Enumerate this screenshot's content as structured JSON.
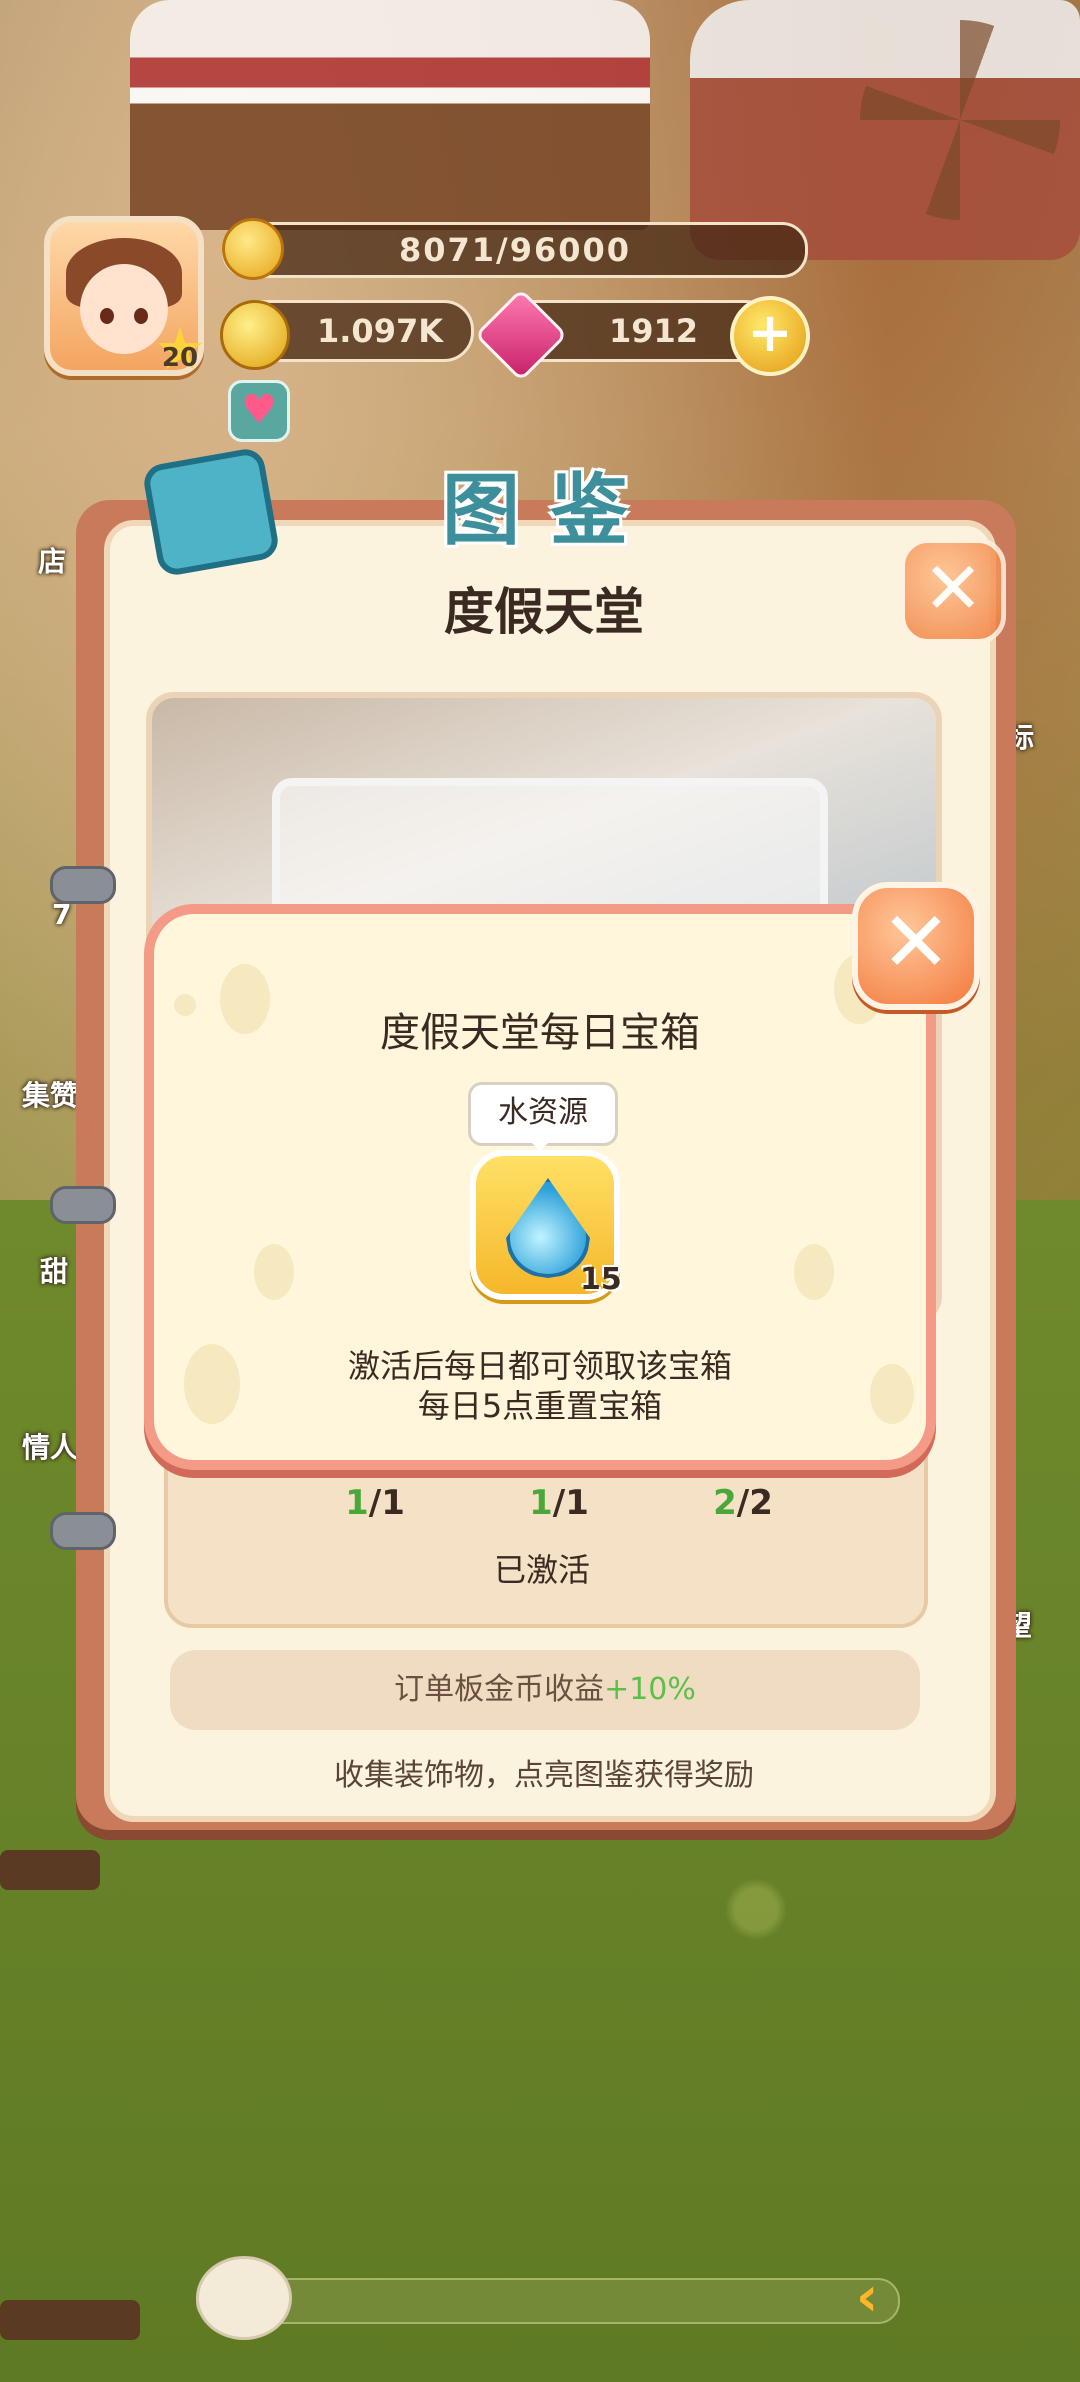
{
  "hud": {
    "level": "20",
    "xp": "8071/96000",
    "coins": "1.097K",
    "gems": "1912",
    "plus_symbol": "+",
    "heart_symbol": "♥"
  },
  "side_labels": {
    "shop": "店",
    "tag": "标",
    "seven": "7",
    "collect": "集赞",
    "sweet": "甜",
    "lover": "情人",
    "wish": "望"
  },
  "album": {
    "banner_title": "图鉴",
    "heading": "度假天堂",
    "close_symbol": "✕",
    "counts": [
      {
        "done": "1",
        "total": "/1"
      },
      {
        "done": "1",
        "total": "/1"
      },
      {
        "done": "2",
        "total": "/2"
      }
    ],
    "status": "已激活",
    "bonus_label": "订单板金币收益",
    "bonus_value": "+10%",
    "footer_hint": "收集装饰物，点亮图鉴获得奖励"
  },
  "popup": {
    "title": "度假天堂每日宝箱",
    "close_symbol": "✕",
    "reward": {
      "name": "水资源",
      "quantity": "15"
    },
    "description_line1": "激活后每日都可领取该宝箱",
    "description_line2": "每日5点重置宝箱"
  },
  "chat": {
    "arrow_symbol": "‹"
  },
  "colors": {
    "popup_border": "#f39b86",
    "popup_bg": "#fff6dc",
    "close_orange": "#f37a3e",
    "done_green": "#4aa83a",
    "banner_teal": "#3e8f9c"
  }
}
